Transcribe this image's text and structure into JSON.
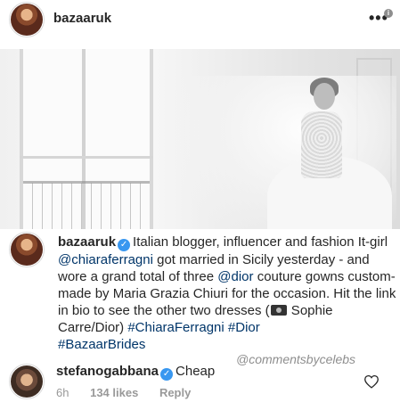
{
  "header": {
    "username": "bazaaruk",
    "more_label": "•••",
    "info_badge": "i"
  },
  "caption": {
    "username": "bazaaruk",
    "verified_icon": "verified-badge-icon",
    "text_1": "Italian blogger, influencer and fashion It-girl ",
    "mention_1": "@chiaraferragni",
    "text_2": " got married in Sicily yesterday - and wore a grand total of three ",
    "mention_2": "@dior",
    "text_3": " couture gowns custom-made by Maria Grazia Chiuri for the occasion. Hit the link in bio to see the other two dresses (",
    "camera_icon": "camera-icon",
    "text_4": " Sophie Carre/Dior) ",
    "hashtag_1": "#ChiaraFerragni",
    "hashtag_2": "#Dior",
    "hashtag_3": "#BazaarBrides"
  },
  "watermark": "@commentsbycelebs",
  "comment": {
    "username": "stefanogabbana",
    "verified_icon": "verified-badge-icon",
    "text": "Cheap",
    "time": "6h",
    "likes": "134 likes",
    "reply_label": "Reply",
    "like_icon": "heart-icon"
  },
  "colors": {
    "link": "#003569",
    "verified": "#3897f0",
    "meta": "#999999"
  }
}
